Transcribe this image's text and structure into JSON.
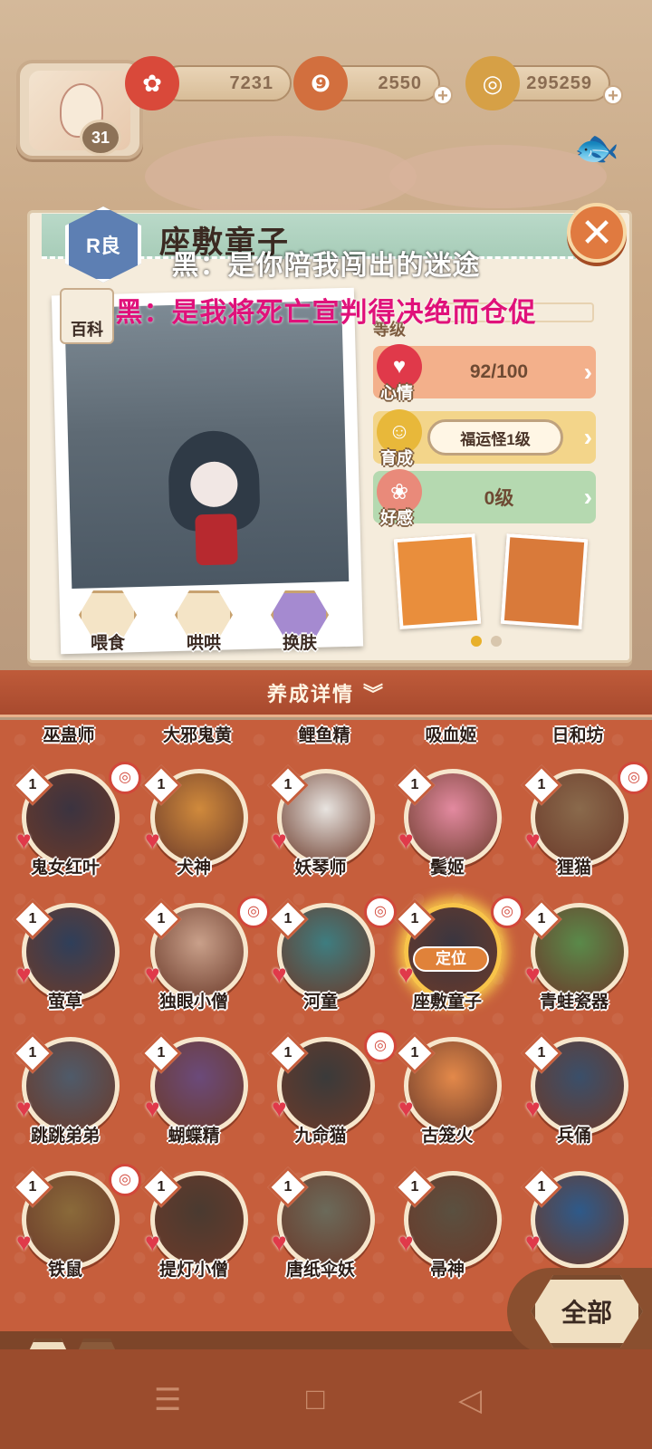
{
  "header": {
    "player_level": "31",
    "resources": [
      {
        "icon": "plum-blossom-icon",
        "value": "7231",
        "color": "#d9493a"
      },
      {
        "icon": "magatama-icon",
        "value": "2550",
        "color": "#d26f3e"
      },
      {
        "icon": "gold-coin-icon",
        "value": "295259",
        "color": "#d6a046"
      }
    ]
  },
  "panel": {
    "rarity": "R良",
    "name": "座敷童子",
    "wiki_label": "百科",
    "level_label": "等级",
    "stats": [
      {
        "label": "心情",
        "value": "92/100",
        "icon": "heart-icon",
        "color": "#f3b08b"
      },
      {
        "label": "育成",
        "value": "福运怪1级",
        "icon": "smile-icon",
        "color": "#f3d58a"
      },
      {
        "label": "好感",
        "value": "0级",
        "icon": "flower-icon",
        "color": "#b5d9b0"
      }
    ],
    "actions": [
      {
        "label": "喂食",
        "icon": "food-bowl-icon"
      },
      {
        "label": "哄哄",
        "icon": "milk-box-icon"
      },
      {
        "label": "换肤",
        "icon": "skin-gem-icon"
      }
    ],
    "card_page": 1,
    "card_pages": 2
  },
  "subtitles": {
    "line1": "黑：是你陪我闯出的迷途",
    "line2": "黑：是我将死亡宣判得决绝而仓促"
  },
  "banner": {
    "label": "养成详情",
    "icon": "double-chevron-down-icon"
  },
  "grid": {
    "partial_row": [
      "巫蛊师",
      "大邪鬼黄",
      "鲤鱼精",
      "吸血姬",
      "日和坊"
    ],
    "rows": [
      [
        {
          "name": "鬼女红叶",
          "level": "1",
          "badge": "steering-icon",
          "color": "#3b3340"
        },
        {
          "name": "犬神",
          "level": "1",
          "badge": "",
          "color": "#d08a3c"
        },
        {
          "name": "妖琴师",
          "level": "1",
          "badge": "",
          "color": "#e8e4e0"
        },
        {
          "name": "鬓姬",
          "level": "1",
          "badge": "",
          "color": "#e38aa0"
        },
        {
          "name": "狸猫",
          "level": "1",
          "badge": "bell-icon",
          "color": "#8a6a4c"
        }
      ],
      [
        {
          "name": "萤草",
          "level": "1",
          "badge": "",
          "color": "#2f3f5a"
        },
        {
          "name": "独眼小僧",
          "level": "1",
          "badge": "target-icon",
          "color": "#c9a08a"
        },
        {
          "name": "河童",
          "level": "1",
          "badge": "wave-icon",
          "color": "#3e7d80"
        },
        {
          "name": "座敷童子",
          "level": "1",
          "badge": "lantern-icon",
          "color": "#3a3640",
          "selected": true,
          "locate_label": "定位"
        },
        {
          "name": "青蛙瓷器",
          "level": "1",
          "badge": "",
          "color": "#5a8a4a"
        }
      ],
      [
        {
          "name": "跳跳弟弟",
          "level": "1",
          "badge": "",
          "color": "#4f5b6a"
        },
        {
          "name": "蝴蝶精",
          "level": "1",
          "badge": "",
          "color": "#6b4a7a"
        },
        {
          "name": "九命猫",
          "level": "1",
          "badge": "wave-icon",
          "color": "#3a3a3a"
        },
        {
          "name": "古笼火",
          "level": "1",
          "badge": "",
          "color": "#e3894a"
        },
        {
          "name": "兵俑",
          "level": "1",
          "badge": "",
          "color": "#3a4f6a"
        }
      ],
      [
        {
          "name": "铁鼠",
          "level": "1",
          "badge": "lantern-icon",
          "color": "#8a6a3a"
        },
        {
          "name": "提灯小僧",
          "level": "1",
          "badge": "",
          "color": "#4a3a30"
        },
        {
          "name": "唐纸伞妖",
          "level": "1",
          "badge": "",
          "color": "#6b6a5a"
        },
        {
          "name": "帚神",
          "level": "1",
          "badge": "",
          "color": "#5a5040"
        },
        {
          "name": "",
          "level": "1",
          "badge": "",
          "color": "#2e5a8a"
        }
      ]
    ]
  },
  "bottom": {
    "all_label": "全部"
  }
}
